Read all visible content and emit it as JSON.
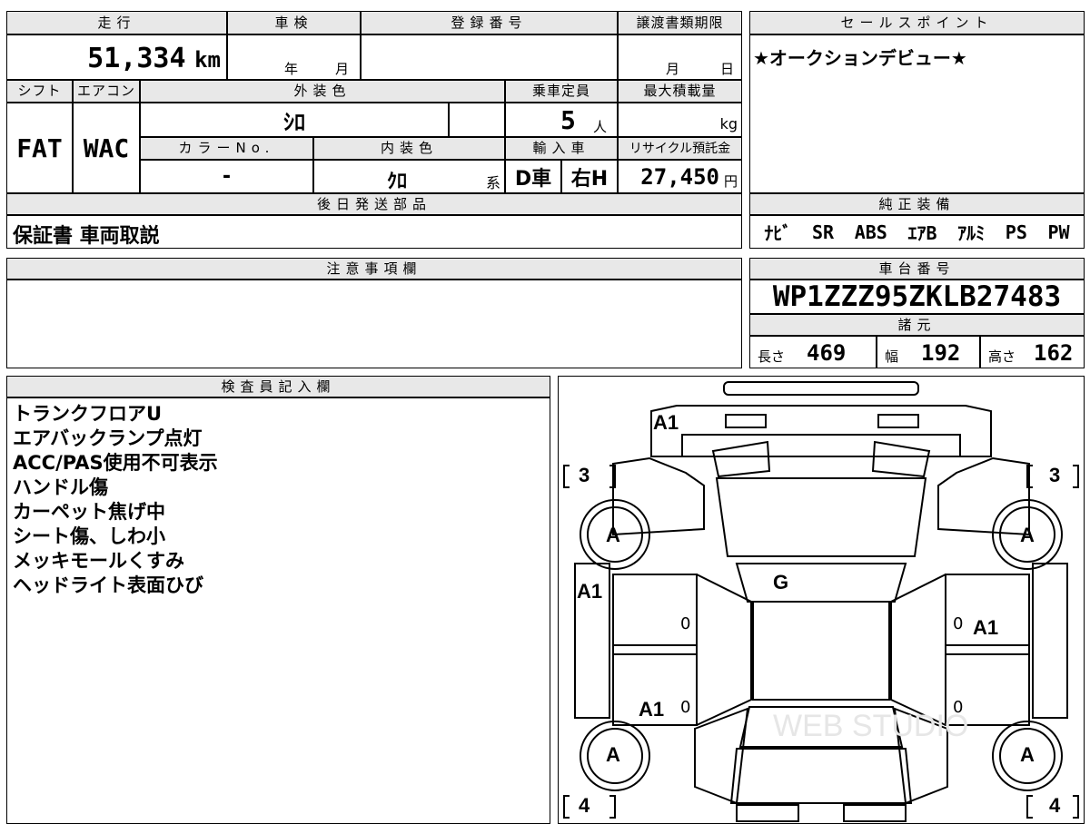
{
  "header": {
    "mileage_label": "走行",
    "inspection_label": "車検",
    "registration_label": "登録番号",
    "transfer_label": "譲渡書類期限",
    "sales_point_label": "セールスポイント"
  },
  "mileage": {
    "value": "51,334",
    "unit": "km"
  },
  "inspection": {
    "year_unit": "年",
    "month_unit": "月"
  },
  "transfer": {
    "month_unit": "月",
    "day_unit": "日"
  },
  "sales_point": "★オークションデビュー★",
  "row2_labels": {
    "shift": "シフト",
    "aircon": "エアコン",
    "exterior": "外装色",
    "capacity": "乗車定員",
    "max_load": "最大積載量"
  },
  "shift": "FAT",
  "aircon": "WAC",
  "exterior_color": "ｼﾛ",
  "capacity": {
    "value": "5",
    "unit": "人"
  },
  "max_load_unit": "kg",
  "row3_labels": {
    "color_no": "カラーNo.",
    "interior": "内装色",
    "import": "輸入車",
    "recycle": "リサイクル預託金"
  },
  "color_no": "-",
  "interior_color": {
    "value": "ｸﾛ",
    "suffix": "系"
  },
  "import": {
    "dealer": "D車",
    "steering": "右H"
  },
  "recycle": {
    "value": "27,450",
    "unit": "円"
  },
  "accessories": {
    "label": "後日発送部品",
    "value": "保証書 車両取説"
  },
  "equipment": {
    "label": "純正装備",
    "items": [
      "ﾅﾋﾞ",
      "SR",
      "ABS",
      "ｴｱB",
      "ｱﾙﾐ",
      "PS",
      "PW"
    ]
  },
  "caution": {
    "label": "注意事項欄"
  },
  "chassis": {
    "label": "車台番号",
    "value": "WP1ZZZ95ZKLB27483"
  },
  "specs": {
    "label": "諸元",
    "length_label": "長さ",
    "length": "469",
    "width_label": "幅",
    "width": "192",
    "height_label": "高さ",
    "height": "162"
  },
  "inspector": {
    "label": "検査員記入欄",
    "notes": [
      "トランクフロアU",
      "エアバックランプ点灯",
      "ACC/PAS使用不可表示",
      "ハンドル傷",
      "カーペット焦げ中",
      "シート傷、しわ小",
      "メッキモールくすみ",
      "ヘッドライト表面ひび"
    ]
  },
  "diagram": {
    "front_left_tire": "3",
    "front_right_tire": "3",
    "rear_left_tire": "4",
    "rear_right_tire": "4",
    "roof": "G",
    "front_bumper": "A1",
    "left_front_door": "A1",
    "left_rear_door": "A1",
    "right_front_door": "A1",
    "wheel": "A",
    "panel_mark": "0",
    "watermark": "WEB STUDIO"
  }
}
